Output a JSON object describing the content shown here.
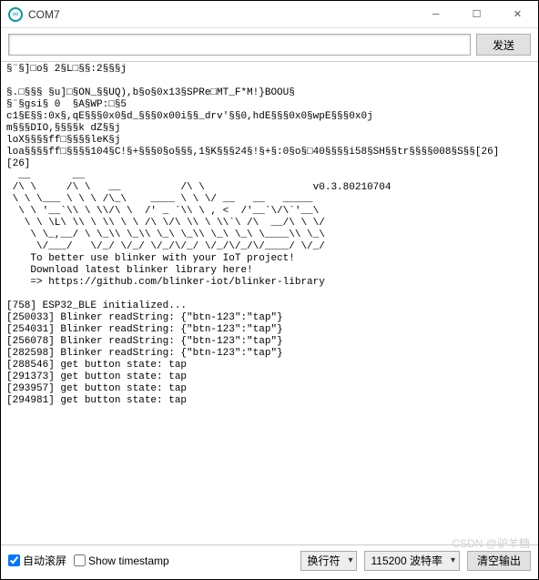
{
  "window": {
    "title": "COM7"
  },
  "toolbar": {
    "send_label": "发送",
    "input_value": ""
  },
  "console_text": "§¨§]□o§ 2§L□§§:2§§§j\n\n§.□§§§ §u]□§ON_§§UQ),b§o§0x13§SPRe□MT_F*M!}BOOU§\n§¨§gsi§ 0  §A§WP:□§5\nc1§E§§:0x§,qE§§§0x0§d_§§§0x00i§§_drv'§§0,hdE§§§0x0§wpE§§§0x0j\nm§§§DIO,§§§§k dZ§§j\nloX§§§§ff□§§§§leK§j\nloa§§§§ff□§§§§104§C!§+§§§0§o§§§,1§K§§§24§!§+§:0§o§□40§§§§i58§SH§§tr§§§§008§S§§[26]\n[26]\n  __       __\n /\\ \\     /\\ \\   __          /\\ \\                  v0.3.80210704\n \\ \\ \\___ \\ \\ \\ /\\_\\    ____ \\ \\ \\/ __   __   _____\n  \\ \\ '__`\\\\ \\ \\\\/\\ \\  /' _ `\\\\ \\ , <  /'__`\\/\\`'__\\\n   \\ \\ \\L\\ \\\\ \\ \\\\ \\ \\ /\\ \\/\\ \\\\ \\ \\\\`\\ /\\  __/\\ \\ \\/\n    \\ \\_,__/ \\ \\_\\\\ \\_\\\\ \\_\\ \\_\\\\ \\_\\ \\_\\ \\____\\\\ \\_\\\n     \\/___/   \\/_/ \\/_/ \\/_/\\/_/ \\/_/\\/_/\\/____/ \\/_/\n    To better use blinker with your IoT project!\n    Download latest blinker library here!\n    => https://github.com/blinker-iot/blinker-library\n\n[758] ESP32_BLE initialized...\n[250033] Blinker readString: {\"btn-123\":\"tap\"}\n[254031] Blinker readString: {\"btn-123\":\"tap\"}\n[256078] Blinker readString: {\"btn-123\":\"tap\"}\n[282598] Blinker readString: {\"btn-123\":\"tap\"}\n[288546] get button state: tap\n[291373] get button state: tap\n[293957] get button state: tap\n[294981] get button state: tap\n",
  "bottombar": {
    "autoscroll_label": "自动滚屏",
    "autoscroll_checked": true,
    "timestamp_label": "Show timestamp",
    "timestamp_checked": false,
    "lineending_selected": "换行符",
    "baud_selected": "115200 波特率",
    "clear_label": "清空输出"
  },
  "watermark": "CSDN @驴羊糖"
}
